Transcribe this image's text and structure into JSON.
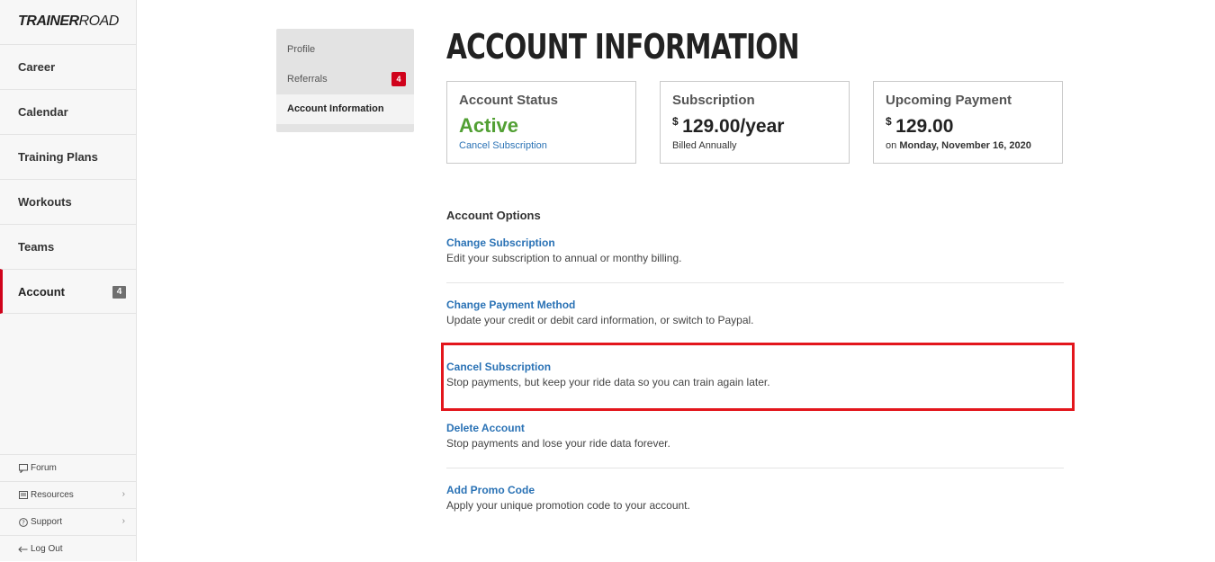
{
  "brand": {
    "bold": "TRAINER",
    "light": "ROAD"
  },
  "nav": {
    "items": [
      {
        "label": "Career"
      },
      {
        "label": "Calendar"
      },
      {
        "label": "Training Plans"
      },
      {
        "label": "Workouts"
      },
      {
        "label": "Teams"
      },
      {
        "label": "Account",
        "badge": "4",
        "active": true
      }
    ],
    "utility": [
      {
        "label": "Forum",
        "icon": "chat-bubble-icon"
      },
      {
        "label": "Resources",
        "icon": "list-icon",
        "chevron": "›"
      },
      {
        "label": "Support",
        "icon": "help-circle-icon",
        "chevron": "›"
      },
      {
        "label": "Log Out",
        "icon": "arrow-left-icon"
      }
    ]
  },
  "subnav": {
    "items": [
      {
        "label": "Profile"
      },
      {
        "label": "Referrals",
        "badge": "4"
      },
      {
        "label": "Account Information",
        "active": true
      }
    ]
  },
  "page": {
    "title": "ACCOUNT INFORMATION"
  },
  "cards": {
    "status": {
      "title": "Account Status",
      "value": "Active",
      "link": "Cancel Subscription"
    },
    "subscription": {
      "title": "Subscription",
      "currency": "$",
      "amount": "129.00/year",
      "note": "Billed Annually"
    },
    "payment": {
      "title": "Upcoming Payment",
      "currency": "$",
      "amount": "129.00",
      "note_prefix": "on",
      "date": "Monday, November 16, 2020"
    }
  },
  "options": {
    "heading": "Account Options",
    "items": [
      {
        "link": "Change Subscription",
        "desc": "Edit your subscription to annual or monthy billing."
      },
      {
        "link": "Change Payment Method",
        "desc": "Update your credit or debit card information, or switch to Paypal."
      },
      {
        "link": "Cancel Subscription",
        "desc": "Stop payments, but keep your ride data so you can train again later."
      },
      {
        "link": "Delete Account",
        "desc": "Stop payments and lose your ride data forever."
      },
      {
        "link": "Add Promo Code",
        "desc": "Apply your unique promotion code to your account."
      }
    ]
  },
  "colors": {
    "accent_red": "#d0021b",
    "link_blue": "#2a72b5",
    "active_green": "#52a034",
    "highlight_red": "#e3161c"
  }
}
